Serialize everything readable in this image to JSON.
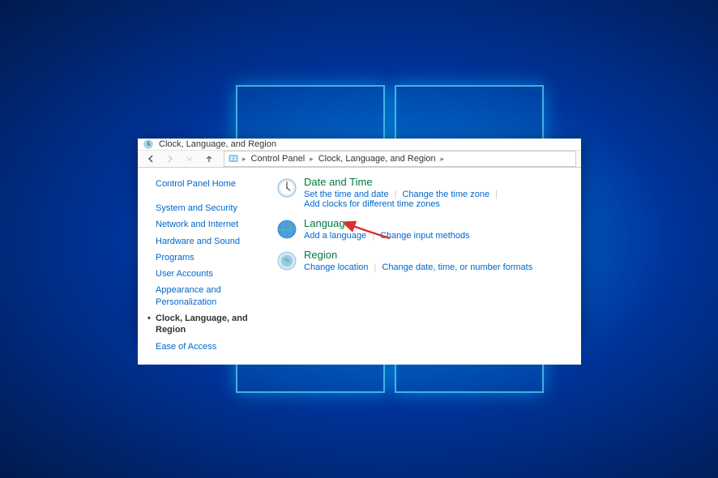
{
  "window": {
    "title": "Clock, Language, and Region"
  },
  "breadcrumb": {
    "items": [
      "Control Panel",
      "Clock, Language, and Region"
    ]
  },
  "sidebar": {
    "home": "Control Panel Home",
    "items": [
      {
        "label": "System and Security",
        "active": false
      },
      {
        "label": "Network and Internet",
        "active": false
      },
      {
        "label": "Hardware and Sound",
        "active": false
      },
      {
        "label": "Programs",
        "active": false
      },
      {
        "label": "User Accounts",
        "active": false
      },
      {
        "label": "Appearance and Personalization",
        "active": false
      },
      {
        "label": "Clock, Language, and Region",
        "active": true
      },
      {
        "label": "Ease of Access",
        "active": false
      }
    ]
  },
  "categories": [
    {
      "icon": "clock-icon",
      "title": "Date and Time",
      "tasks": [
        "Set the time and date",
        "Change the time zone",
        "Add clocks for different time zones"
      ]
    },
    {
      "icon": "globe-icon",
      "title": "Language",
      "tasks": [
        "Add a language",
        "Change input methods"
      ]
    },
    {
      "icon": "region-icon",
      "title": "Region",
      "tasks": [
        "Change location",
        "Change date, time, or number formats"
      ]
    }
  ]
}
